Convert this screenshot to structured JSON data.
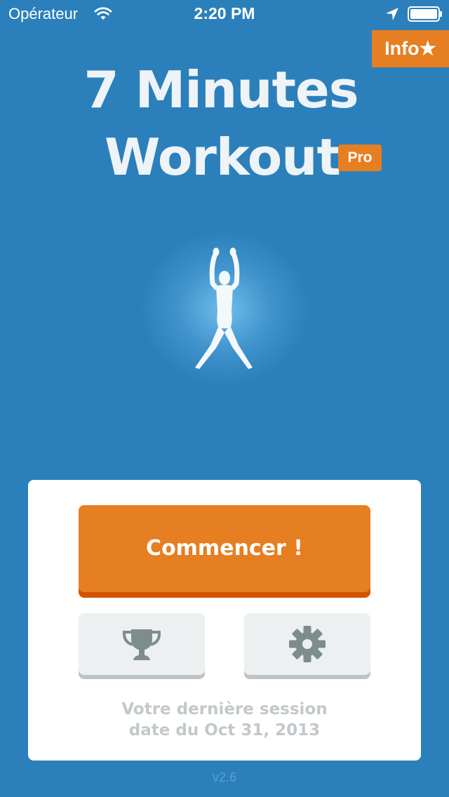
{
  "status_bar": {
    "carrier": "Opérateur",
    "time": "2:20 PM",
    "icons": [
      "wifi-icon",
      "location-icon",
      "battery-icon"
    ]
  },
  "info_button": {
    "label": "Info★"
  },
  "title": {
    "line1": "7 Minutes",
    "line2": "Workout",
    "badge": "Pro"
  },
  "figure": {
    "icon": "jumping-jacks-figure-icon"
  },
  "card": {
    "start_label": "Commencer !",
    "trophy_icon": "trophy-icon",
    "settings_icon": "gear-icon",
    "last_session_line1": "Votre dernière session",
    "last_session_line2": "date du Oct 31, 2013"
  },
  "version": "v2.6",
  "colors": {
    "background": "#2b80bb",
    "accent": "#e67e22",
    "accent_shadow": "#d35400",
    "card": "#ffffff",
    "button_gray": "#ecf0f1",
    "icon_gray": "#7f8c8d"
  }
}
